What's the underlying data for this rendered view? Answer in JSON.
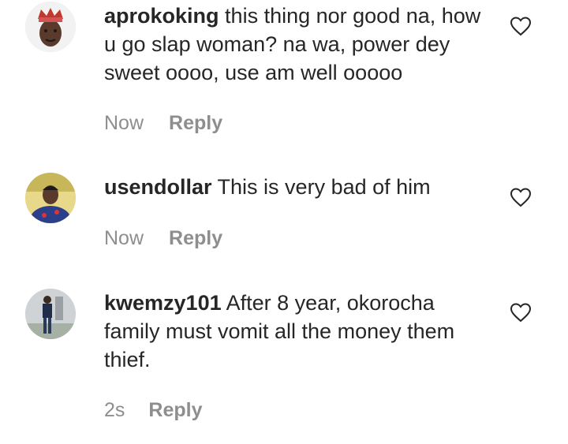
{
  "comments": [
    {
      "username": "aprokoking",
      "text": "this thing nor good na, how u go slap woman? na wa, power dey sweet oooo, use am well ooooo",
      "time": "Now",
      "reply_label": "Reply",
      "avatar_icon": "person-with-crown-avatar",
      "like_icon": "heart-outline-icon"
    },
    {
      "username": "usendollar",
      "text": "This is very bad of him",
      "time": "Now",
      "reply_label": "Reply",
      "avatar_icon": "person-avatar",
      "like_icon": "heart-outline-icon"
    },
    {
      "username": "kwemzy101",
      "text": "After 8 year, okorocha family must vomit all the money them thief.",
      "time": "2s",
      "reply_label": "Reply",
      "avatar_icon": "standing-person-avatar",
      "like_icon": "heart-outline-icon"
    }
  ],
  "colors": {
    "text": "#262626",
    "secondary": "#8e8e8e",
    "background": "#ffffff"
  }
}
